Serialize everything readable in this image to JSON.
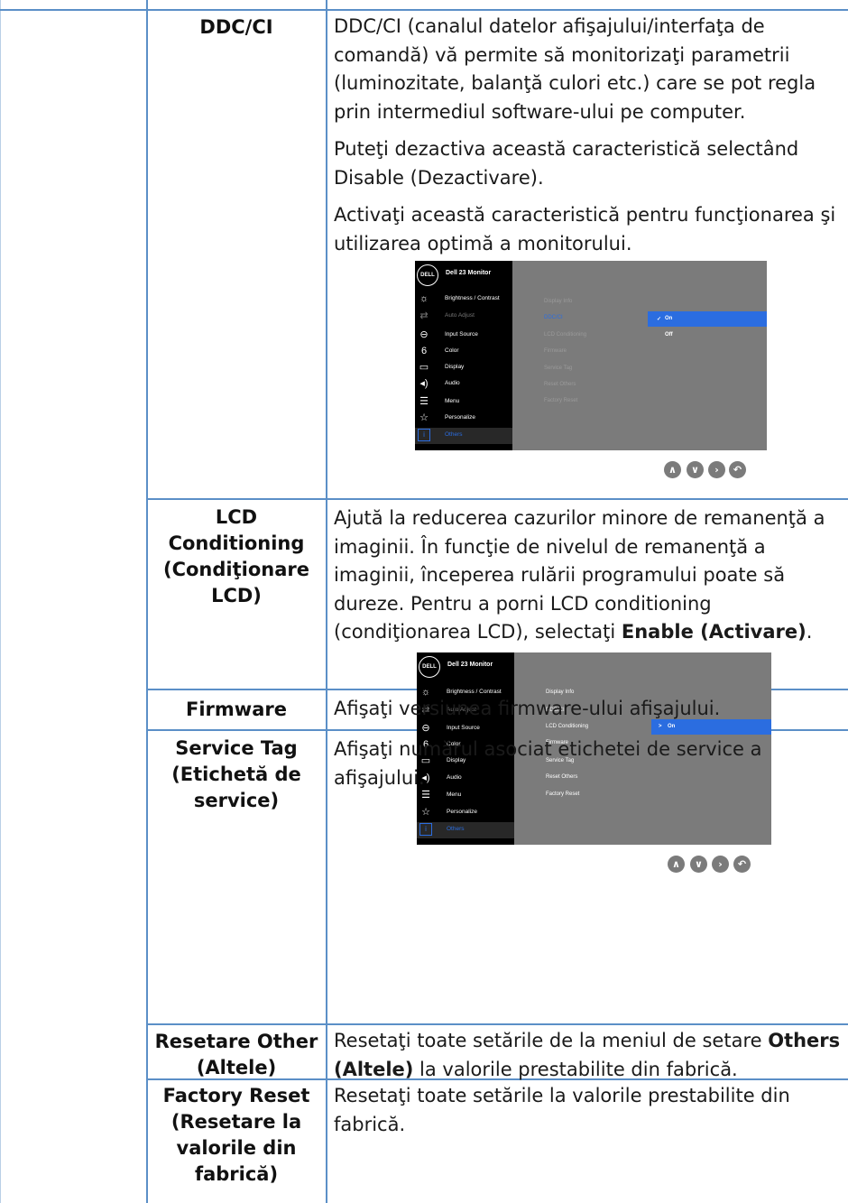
{
  "rows": {
    "ddcci": {
      "label": "DDC/CI",
      "p1": "DDC/CI (canalul datelor afişajului/interfaţa de comandă) vă permite să monitorizaţi parametrii (luminozitate, balanţă culori etc.) care se pot regla prin intermediul software-ului pe computer.",
      "p2": "Puteţi dezactiva această caracteristică selectând Disable (Dezactivare).",
      "p3": "Activaţi această caracteristică pentru funcţionarea şi utilizarea optimă a monitorului."
    },
    "lcd": {
      "label_l1": "LCD",
      "label_l2": "Conditioning",
      "label_l3": "(Condiţionare",
      "label_l4": "LCD)",
      "text": "Ajută la reducerea cazurilor minore de remanenţă a imaginii. În funcţie de nivelul de remanenţă a imaginii, începerea rulării programului poate să dureze. Pentru a porni LCD conditioning (condiţionarea LCD), selectaţi ",
      "text_bold": "Enable (Activare)",
      "text_end": "."
    },
    "firmware": {
      "label": "Firmware",
      "text": "Afişaţi versiunea firmware-ului afişajului."
    },
    "service_tag": {
      "label_l1": "Service Tag",
      "label_l2": "(Etichetă de",
      "label_l3": "service)",
      "text": "Afişaţi numărul asociat etichetei de service a afişajului."
    },
    "reset_other": {
      "label_l1": "Resetare Other",
      "label_l2": "(Altele)",
      "text": "Resetaţi toate setările de la meniul de setare ",
      "text_bold": "Others (Altele)",
      "text_end": " la valorile prestabilite din fabrică."
    },
    "factory_reset": {
      "label_l1": "Factory Reset",
      "label_l2": "(Resetare la",
      "label_l3": "valorile din",
      "label_l4": "fabrică)",
      "text": "Resetaţi toate setările la valorile prestabilite din fabrică."
    }
  },
  "osd": {
    "logo": "DELL",
    "model": "Dell 23 Monitor",
    "menu": [
      "Brightness / Contrast",
      "Auto Adjust",
      "Input Source",
      "Color",
      "Display",
      "Audio",
      "Menu",
      "Personalize",
      "Others"
    ],
    "icons": [
      "sun-icon",
      "auto-adjust-icon",
      "input-source-icon",
      "color-icon",
      "display-icon",
      "audio-icon",
      "menu-icon",
      "personalize-icon",
      "others-icon"
    ],
    "submenu": [
      "Display Info",
      "DDC/CI",
      "LCD Conditioning",
      "Firmware",
      "Service Tag",
      "Reset Others",
      "Factory Reset"
    ],
    "ddcci_options": [
      "On",
      "Off"
    ],
    "lcd_options": [
      "On"
    ]
  },
  "colors": {
    "rule": "#5b8fc7",
    "osd_bg": "#7b7b7b",
    "osd_highlight": "#2b6de0"
  }
}
